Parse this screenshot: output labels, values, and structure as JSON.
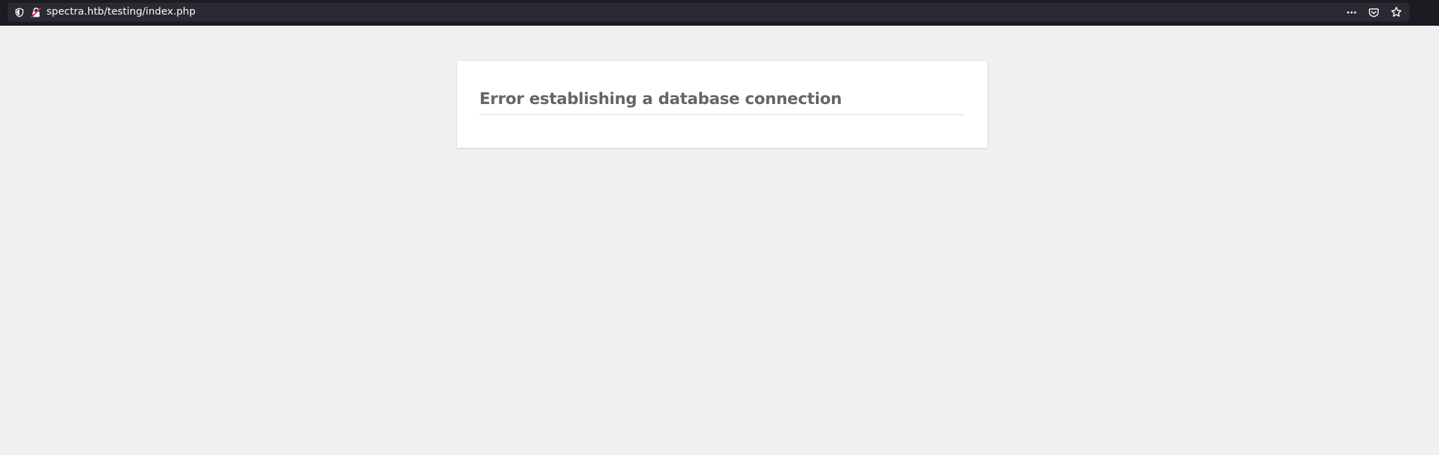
{
  "browser": {
    "url": "spectra.htb/testing/index.php",
    "icons": {
      "tracking": "shield-icon",
      "connection": "insecure-lock-icon",
      "page_actions": "more-horizontal-icon",
      "pocket": "pocket-icon",
      "bookmark": "star-icon"
    },
    "colors": {
      "toolbar": "#1c1b22",
      "urlbar": "#2b2a33",
      "text": "#fbfbfe",
      "insecure_accent": "#e22850"
    }
  },
  "page": {
    "background": "#f0f0f0",
    "error_message": "Error establishing a database connection"
  }
}
